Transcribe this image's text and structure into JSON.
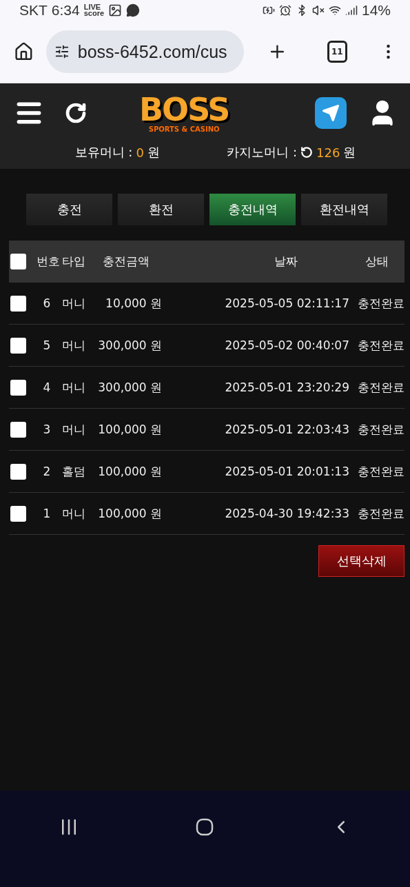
{
  "status_bar": {
    "carrier": "SKT",
    "time": "6:34",
    "live_icon": {
      "top": "LIVE",
      "bottom": "score"
    },
    "battery": "14%"
  },
  "browser": {
    "url": "boss-6452.com/cus",
    "tab_count": "11"
  },
  "header": {
    "logo": {
      "title": "BOSS",
      "subtitle": "SPORTS & CASINO"
    },
    "balances": [
      {
        "label": "보유머니 :",
        "value": "0",
        "unit": "원",
        "refresh": false
      },
      {
        "label": "카지노머니 :",
        "value": "126",
        "unit": "원",
        "refresh": true
      }
    ]
  },
  "tabs": [
    {
      "label": "충전",
      "selected": false
    },
    {
      "label": "환전",
      "selected": false
    },
    {
      "label": "충전내역",
      "selected": true
    },
    {
      "label": "환전내역",
      "selected": false
    }
  ],
  "table": {
    "select_all_checked": false,
    "columns": [
      "번호",
      "타입",
      "충전금액",
      "날짜",
      "상태"
    ],
    "rows": [
      {
        "checked": false,
        "no": "6",
        "type": "머니",
        "amount": "10,000 원",
        "date": "2025-05-05 02:11:17",
        "status": "충전완료"
      },
      {
        "checked": false,
        "no": "5",
        "type": "머니",
        "amount": "300,000 원",
        "date": "2025-05-02 00:40:07",
        "status": "충전완료"
      },
      {
        "checked": false,
        "no": "4",
        "type": "머니",
        "amount": "300,000 원",
        "date": "2025-05-01 23:20:29",
        "status": "충전완료"
      },
      {
        "checked": false,
        "no": "3",
        "type": "머니",
        "amount": "100,000 원",
        "date": "2025-05-01 22:03:43",
        "status": "충전완료"
      },
      {
        "checked": false,
        "no": "2",
        "type": "홀덤",
        "amount": "100,000 원",
        "date": "2025-05-01 20:01:13",
        "status": "충전완료"
      },
      {
        "checked": false,
        "no": "1",
        "type": "머니",
        "amount": "100,000 원",
        "date": "2025-04-30 19:42:33",
        "status": "충전완료"
      }
    ]
  },
  "delete_button": "선택삭제"
}
